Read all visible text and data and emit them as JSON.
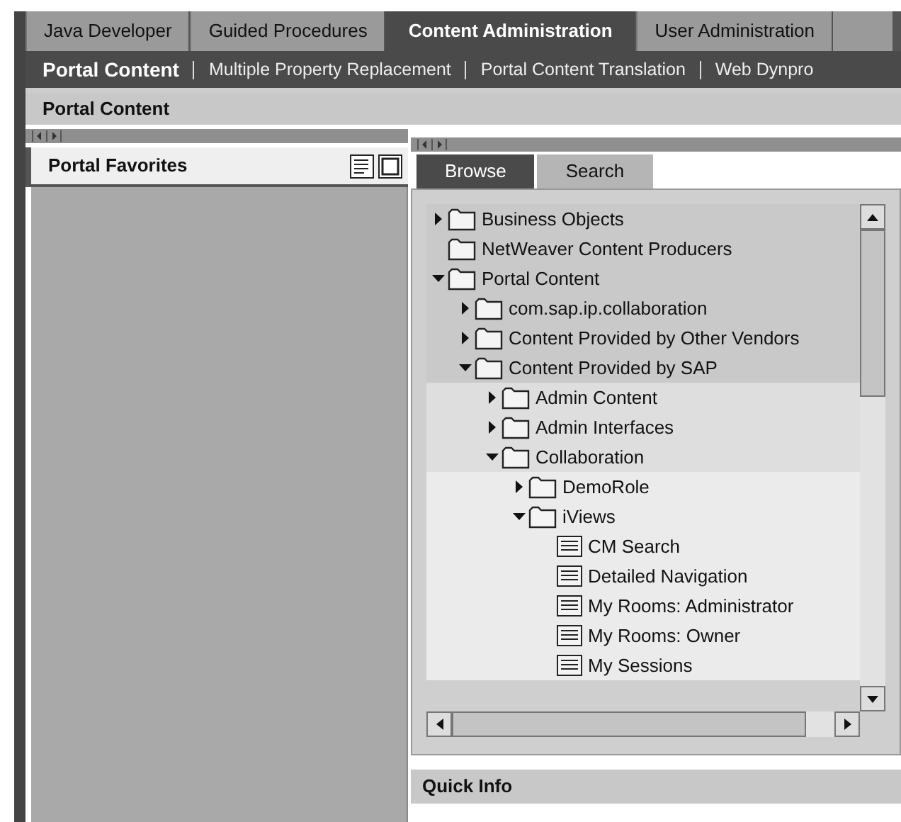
{
  "top_tabs": [
    {
      "label": "Java Developer",
      "selected": false
    },
    {
      "label": "Guided Procedures",
      "selected": false
    },
    {
      "label": "Content Administration",
      "selected": true
    },
    {
      "label": "User Administration",
      "selected": false
    }
  ],
  "sub_nav": [
    {
      "label": "Portal Content",
      "selected": true
    },
    {
      "label": "Multiple Property Replacement",
      "selected": false
    },
    {
      "label": "Portal Content Translation",
      "selected": false
    },
    {
      "label": "Web Dynpro",
      "selected": false
    }
  ],
  "page_title": "Portal Content",
  "favorites": {
    "title": "Portal Favorites"
  },
  "browser_tabs": [
    {
      "label": "Browse",
      "selected": true
    },
    {
      "label": "Search",
      "selected": false
    }
  ],
  "tree": [
    {
      "kind": "folder",
      "label": "Business Objects",
      "expanded": false
    },
    {
      "kind": "leaf-folder",
      "label": "NetWeaver Content Producers"
    },
    {
      "kind": "folder",
      "label": "Portal Content",
      "expanded": true,
      "children": [
        {
          "kind": "folder",
          "label": "com.sap.ip.collaboration",
          "expanded": false
        },
        {
          "kind": "folder",
          "label": "Content Provided by Other Vendors",
          "expanded": false
        },
        {
          "kind": "folder",
          "label": "Content Provided by SAP",
          "expanded": true,
          "children": [
            {
              "kind": "folder",
              "label": "Admin Content",
              "expanded": false
            },
            {
              "kind": "folder",
              "label": "Admin Interfaces",
              "expanded": false
            },
            {
              "kind": "folder",
              "label": "Collaboration",
              "expanded": true,
              "children": [
                {
                  "kind": "folder",
                  "label": "DemoRole",
                  "expanded": false
                },
                {
                  "kind": "folder",
                  "label": "iViews",
                  "expanded": true,
                  "children": [
                    {
                      "kind": "iview",
                      "label": "CM Search"
                    },
                    {
                      "kind": "iview",
                      "label": "Detailed Navigation"
                    },
                    {
                      "kind": "iview",
                      "label": "My Rooms: Administrator"
                    },
                    {
                      "kind": "iview",
                      "label": "My Rooms: Owner"
                    },
                    {
                      "kind": "iview",
                      "label": "My Sessions"
                    }
                  ]
                }
              ]
            }
          ]
        }
      ]
    }
  ],
  "quick_info": {
    "title": "Quick Info"
  }
}
